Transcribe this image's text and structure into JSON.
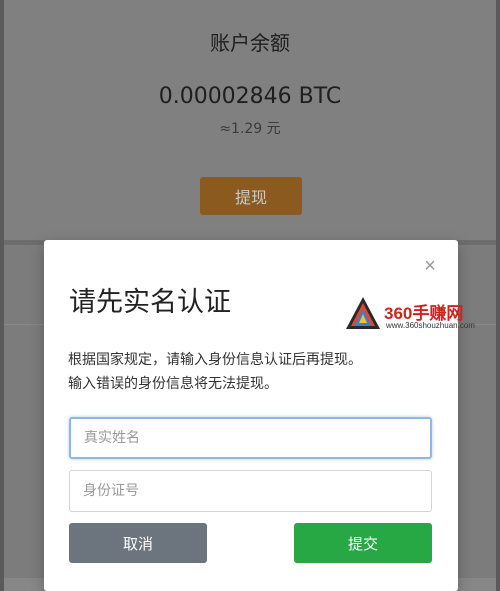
{
  "balance": {
    "title": "账户余额",
    "btc_amount": "0.00002846 BTC",
    "cny_amount": "≈1.29 元",
    "withdraw_label": "提现"
  },
  "modal": {
    "title": "请先实名认证",
    "close_icon": "×",
    "message_line1": "根据国家规定，请输入身份信息认证后再提现。",
    "message_line2": "输入错误的身份信息将无法提现。",
    "name_placeholder": "真实姓名",
    "id_placeholder": "身份证号",
    "cancel_label": "取消",
    "submit_label": "提交"
  },
  "watermark": {
    "brand": "360手赚网",
    "url": "www.360shouzhuan.com"
  },
  "colors": {
    "submit": "#28a745",
    "cancel": "#6c757d",
    "withdraw": "#8a5a1e",
    "watermark": "#d0241b"
  }
}
